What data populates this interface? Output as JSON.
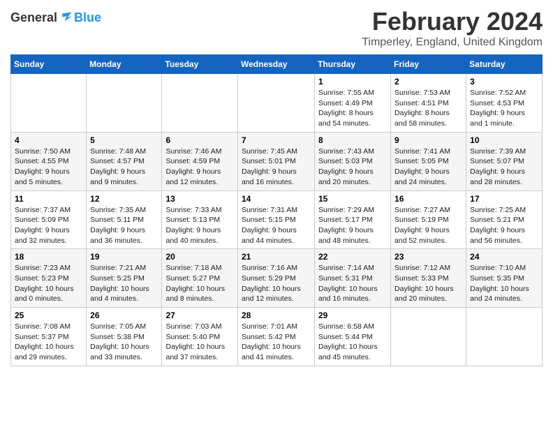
{
  "logo": {
    "text_general": "General",
    "text_blue": "Blue"
  },
  "title": "February 2024",
  "subtitle": "Timperley, England, United Kingdom",
  "days_of_week": [
    "Sunday",
    "Monday",
    "Tuesday",
    "Wednesday",
    "Thursday",
    "Friday",
    "Saturday"
  ],
  "weeks": [
    [
      {
        "day": "",
        "info": ""
      },
      {
        "day": "",
        "info": ""
      },
      {
        "day": "",
        "info": ""
      },
      {
        "day": "",
        "info": ""
      },
      {
        "day": "1",
        "info": "Sunrise: 7:55 AM\nSunset: 4:49 PM\nDaylight: 8 hours\nand 54 minutes."
      },
      {
        "day": "2",
        "info": "Sunrise: 7:53 AM\nSunset: 4:51 PM\nDaylight: 8 hours\nand 58 minutes."
      },
      {
        "day": "3",
        "info": "Sunrise: 7:52 AM\nSunset: 4:53 PM\nDaylight: 9 hours\nand 1 minute."
      }
    ],
    [
      {
        "day": "4",
        "info": "Sunrise: 7:50 AM\nSunset: 4:55 PM\nDaylight: 9 hours\nand 5 minutes."
      },
      {
        "day": "5",
        "info": "Sunrise: 7:48 AM\nSunset: 4:57 PM\nDaylight: 9 hours\nand 9 minutes."
      },
      {
        "day": "6",
        "info": "Sunrise: 7:46 AM\nSunset: 4:59 PM\nDaylight: 9 hours\nand 12 minutes."
      },
      {
        "day": "7",
        "info": "Sunrise: 7:45 AM\nSunset: 5:01 PM\nDaylight: 9 hours\nand 16 minutes."
      },
      {
        "day": "8",
        "info": "Sunrise: 7:43 AM\nSunset: 5:03 PM\nDaylight: 9 hours\nand 20 minutes."
      },
      {
        "day": "9",
        "info": "Sunrise: 7:41 AM\nSunset: 5:05 PM\nDaylight: 9 hours\nand 24 minutes."
      },
      {
        "day": "10",
        "info": "Sunrise: 7:39 AM\nSunset: 5:07 PM\nDaylight: 9 hours\nand 28 minutes."
      }
    ],
    [
      {
        "day": "11",
        "info": "Sunrise: 7:37 AM\nSunset: 5:09 PM\nDaylight: 9 hours\nand 32 minutes."
      },
      {
        "day": "12",
        "info": "Sunrise: 7:35 AM\nSunset: 5:11 PM\nDaylight: 9 hours\nand 36 minutes."
      },
      {
        "day": "13",
        "info": "Sunrise: 7:33 AM\nSunset: 5:13 PM\nDaylight: 9 hours\nand 40 minutes."
      },
      {
        "day": "14",
        "info": "Sunrise: 7:31 AM\nSunset: 5:15 PM\nDaylight: 9 hours\nand 44 minutes."
      },
      {
        "day": "15",
        "info": "Sunrise: 7:29 AM\nSunset: 5:17 PM\nDaylight: 9 hours\nand 48 minutes."
      },
      {
        "day": "16",
        "info": "Sunrise: 7:27 AM\nSunset: 5:19 PM\nDaylight: 9 hours\nand 52 minutes."
      },
      {
        "day": "17",
        "info": "Sunrise: 7:25 AM\nSunset: 5:21 PM\nDaylight: 9 hours\nand 56 minutes."
      }
    ],
    [
      {
        "day": "18",
        "info": "Sunrise: 7:23 AM\nSunset: 5:23 PM\nDaylight: 10 hours\nand 0 minutes."
      },
      {
        "day": "19",
        "info": "Sunrise: 7:21 AM\nSunset: 5:25 PM\nDaylight: 10 hours\nand 4 minutes."
      },
      {
        "day": "20",
        "info": "Sunrise: 7:18 AM\nSunset: 5:27 PM\nDaylight: 10 hours\nand 8 minutes."
      },
      {
        "day": "21",
        "info": "Sunrise: 7:16 AM\nSunset: 5:29 PM\nDaylight: 10 hours\nand 12 minutes."
      },
      {
        "day": "22",
        "info": "Sunrise: 7:14 AM\nSunset: 5:31 PM\nDaylight: 10 hours\nand 16 minutes."
      },
      {
        "day": "23",
        "info": "Sunrise: 7:12 AM\nSunset: 5:33 PM\nDaylight: 10 hours\nand 20 minutes."
      },
      {
        "day": "24",
        "info": "Sunrise: 7:10 AM\nSunset: 5:35 PM\nDaylight: 10 hours\nand 24 minutes."
      }
    ],
    [
      {
        "day": "25",
        "info": "Sunrise: 7:08 AM\nSunset: 5:37 PM\nDaylight: 10 hours\nand 29 minutes."
      },
      {
        "day": "26",
        "info": "Sunrise: 7:05 AM\nSunset: 5:38 PM\nDaylight: 10 hours\nand 33 minutes."
      },
      {
        "day": "27",
        "info": "Sunrise: 7:03 AM\nSunset: 5:40 PM\nDaylight: 10 hours\nand 37 minutes."
      },
      {
        "day": "28",
        "info": "Sunrise: 7:01 AM\nSunset: 5:42 PM\nDaylight: 10 hours\nand 41 minutes."
      },
      {
        "day": "29",
        "info": "Sunrise: 6:58 AM\nSunset: 5:44 PM\nDaylight: 10 hours\nand 45 minutes."
      },
      {
        "day": "",
        "info": ""
      },
      {
        "day": "",
        "info": ""
      }
    ]
  ]
}
